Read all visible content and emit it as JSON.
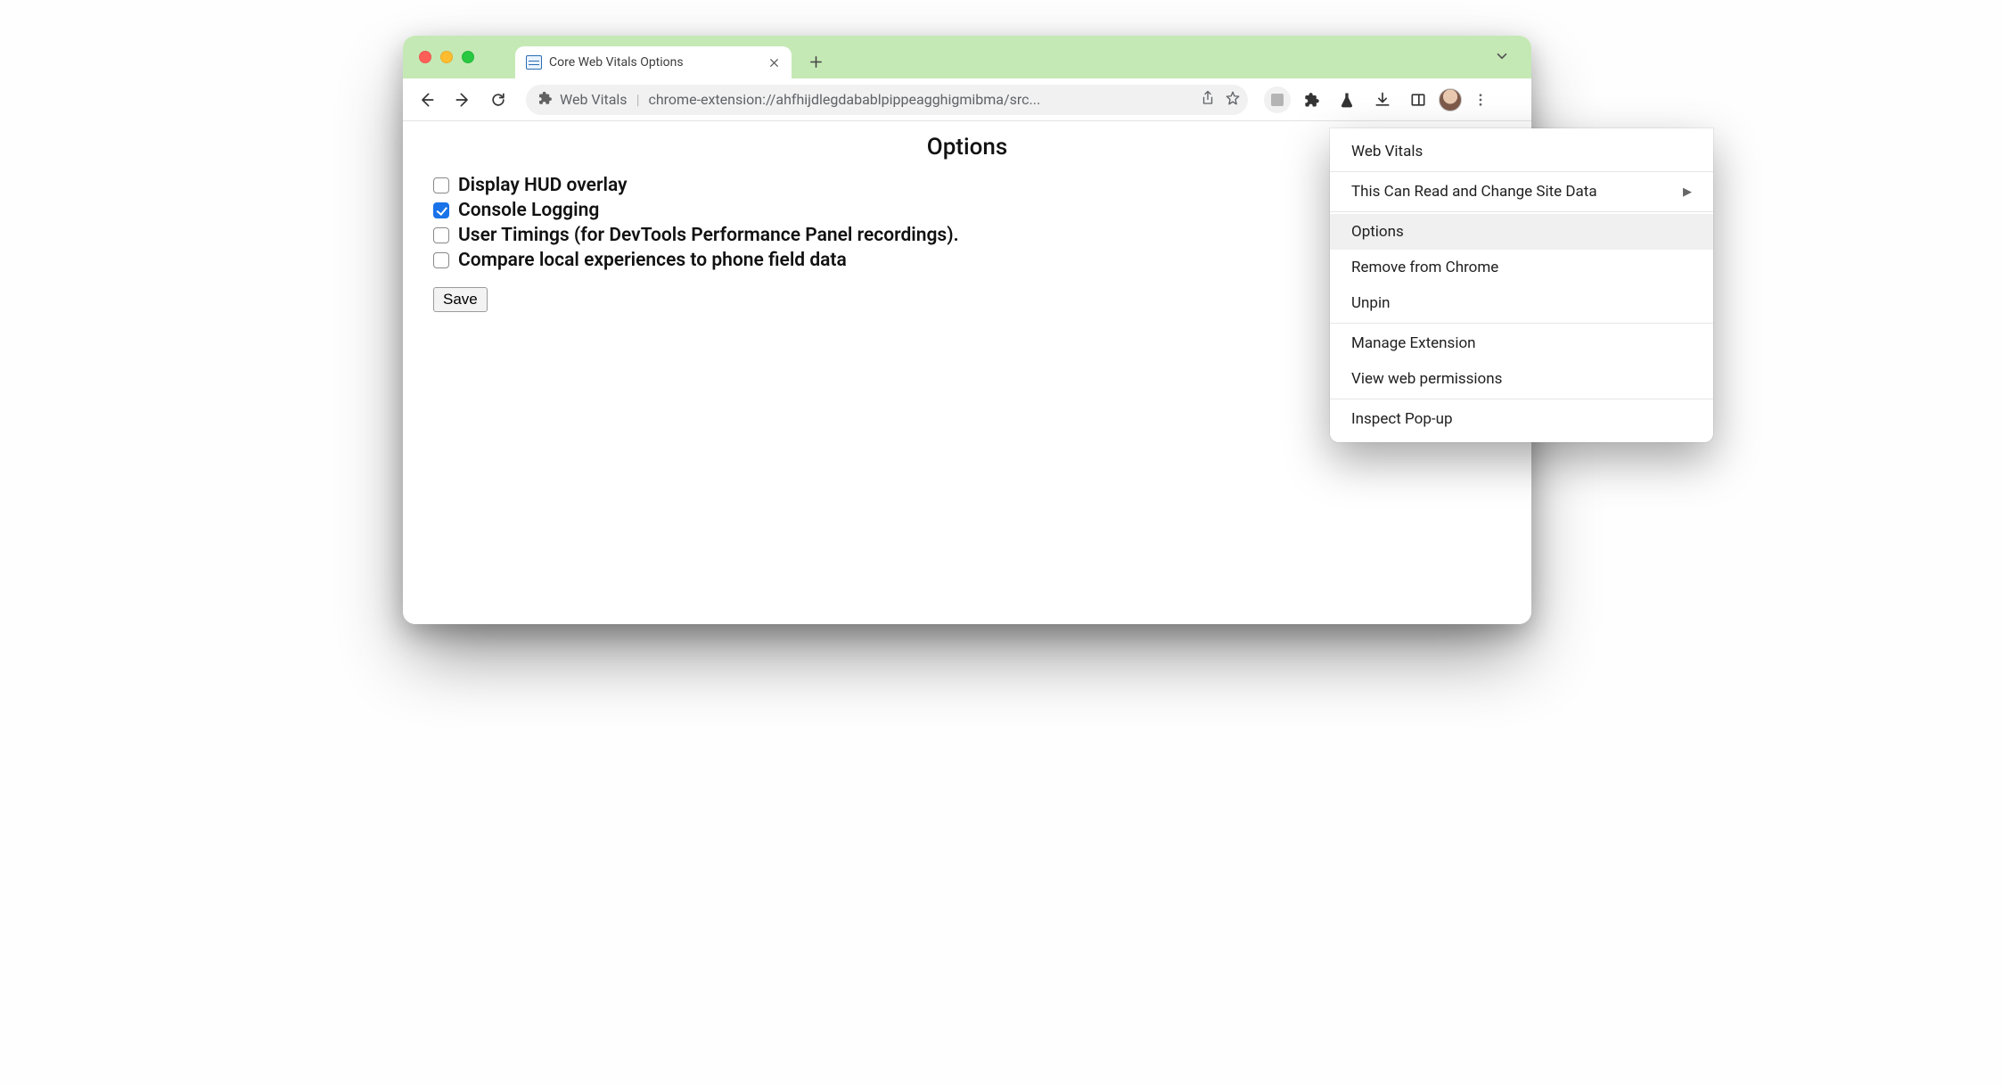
{
  "tab": {
    "title": "Core Web Vitals Options"
  },
  "omnibox": {
    "extension_name": "Web Vitals",
    "url_display": "chrome-extension://ahfhijdlegdabablpippeagghigmibma/src..."
  },
  "page": {
    "heading": "Options",
    "options": [
      {
        "label": "Display HUD overlay",
        "checked": false
      },
      {
        "label": "Console Logging",
        "checked": true
      },
      {
        "label": "User Timings (for DevTools Performance Panel recordings).",
        "checked": false
      },
      {
        "label": "Compare local experiences to phone field data",
        "checked": false
      }
    ],
    "save_label": "Save"
  },
  "context_menu": {
    "header": "Web Vitals",
    "site_data": "This Can Read and Change Site Data",
    "options": "Options",
    "remove": "Remove from Chrome",
    "unpin": "Unpin",
    "manage": "Manage Extension",
    "view_perms": "View web permissions",
    "inspect": "Inspect Pop-up"
  }
}
